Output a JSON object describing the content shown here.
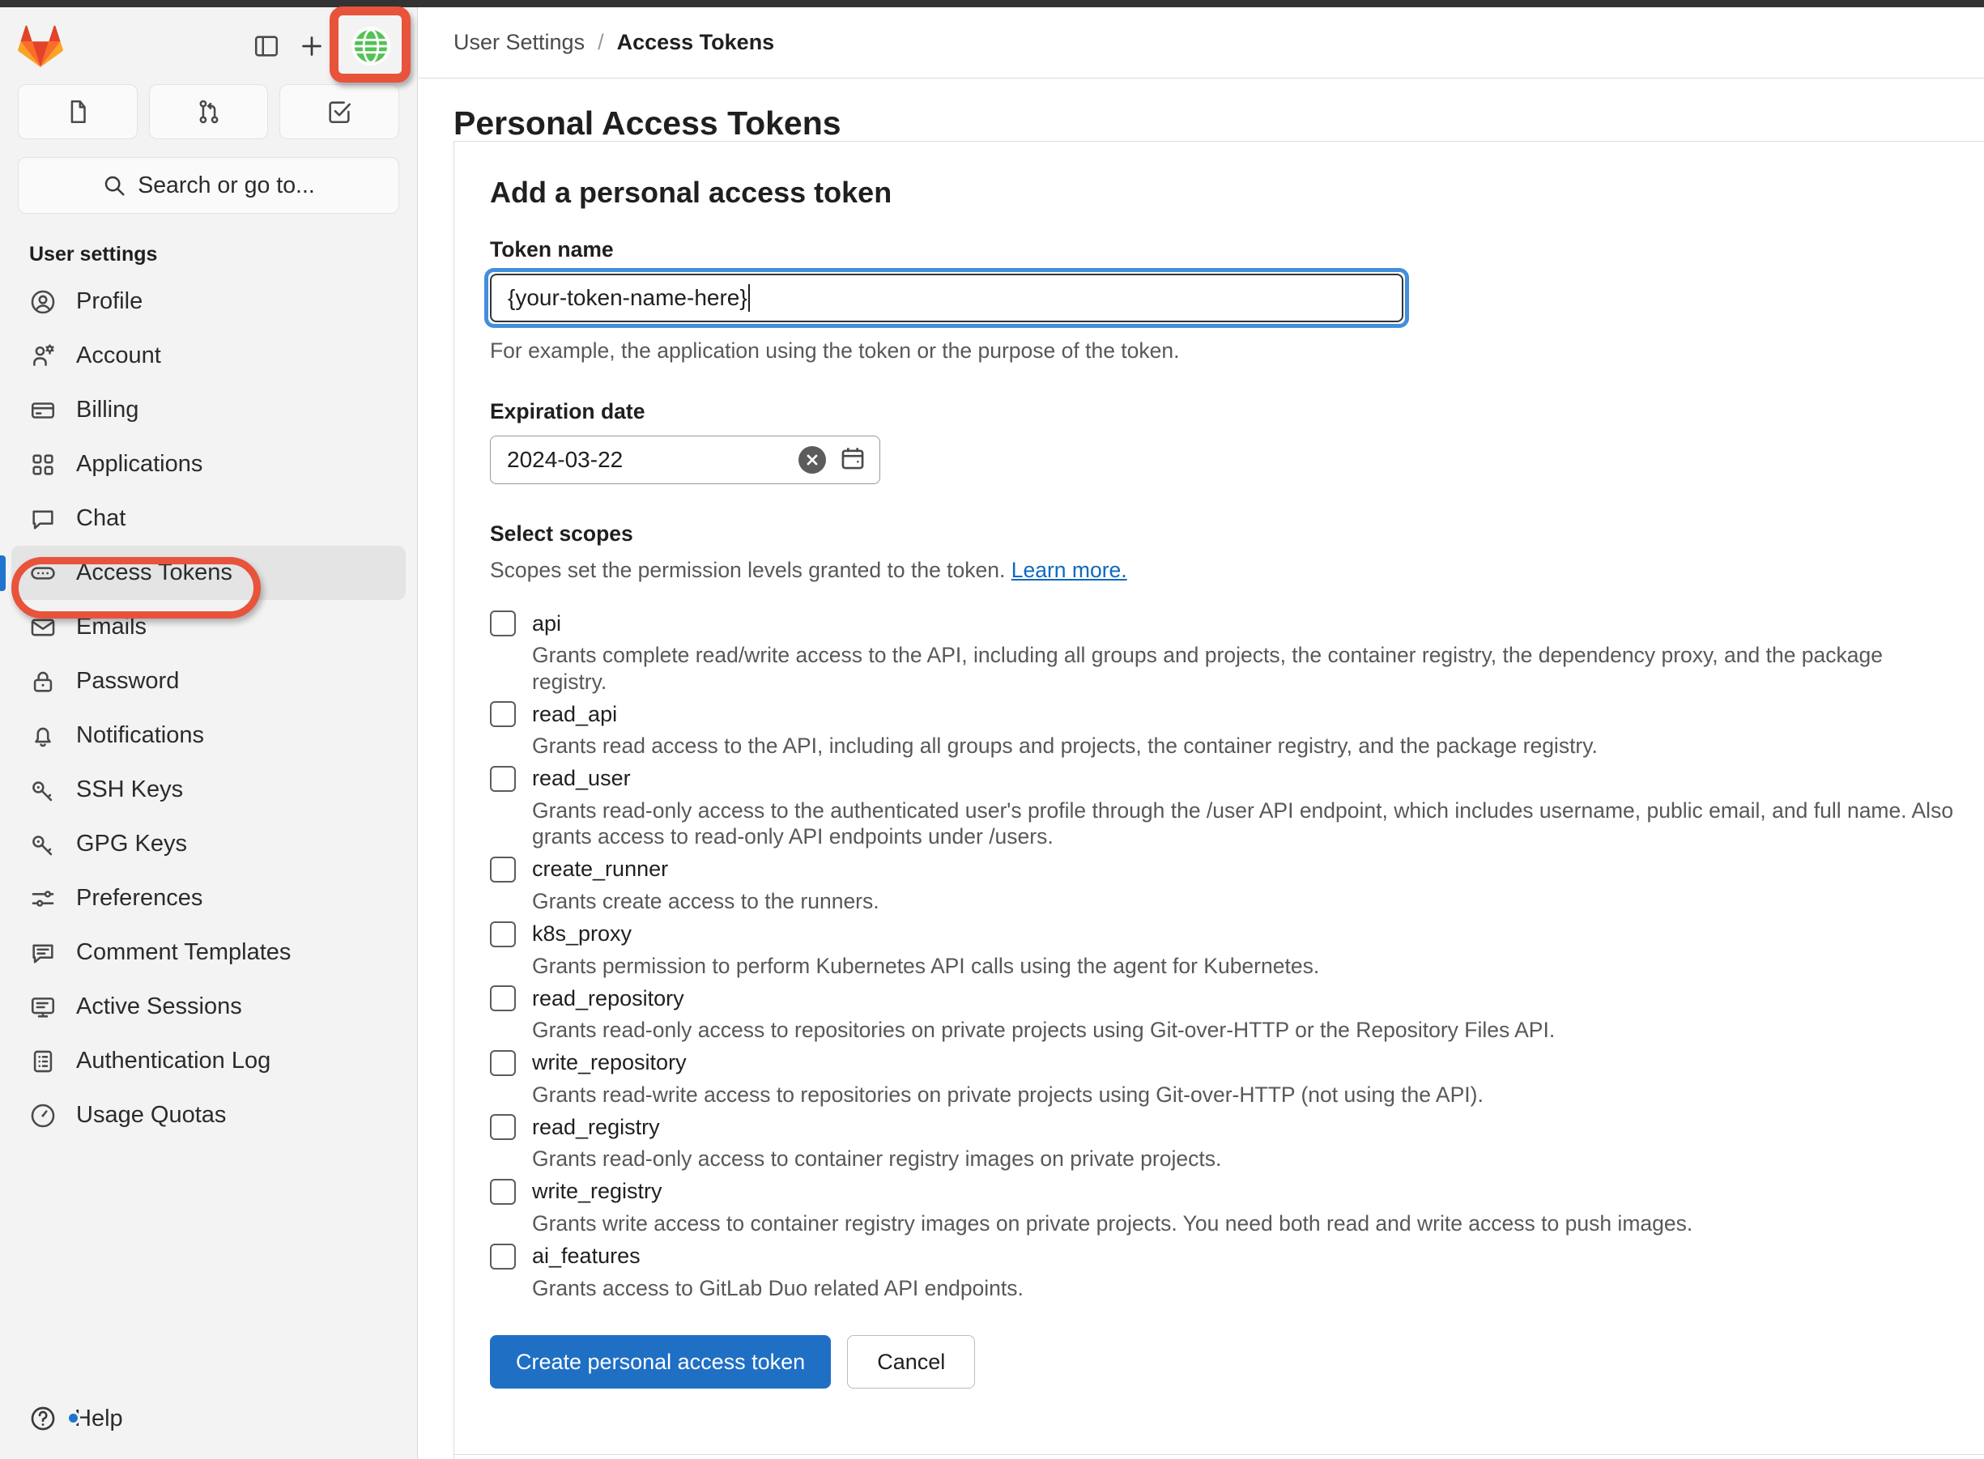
{
  "window": {
    "titlebar_color": "#333333"
  },
  "sidebar": {
    "logo": "gitlab-logo",
    "top_actions": [
      {
        "name": "toggle-sidebar-icon",
        "label": "Toggle sidebar"
      },
      {
        "name": "create-new-icon",
        "label": "Create new"
      },
      {
        "name": "user-avatar",
        "label": "User avatar"
      }
    ],
    "quick_actions": [
      {
        "name": "issues-icon",
        "label": "Issues"
      },
      {
        "name": "merge-requests-icon",
        "label": "Merge requests"
      },
      {
        "name": "todos-icon",
        "label": "To-Do List"
      }
    ],
    "search": {
      "placeholder": "Search or go to...",
      "icon": "search-icon"
    },
    "heading": "User settings",
    "items": [
      {
        "label": "Profile",
        "icon": "user-circle-icon",
        "active": false
      },
      {
        "label": "Account",
        "icon": "user-gear-icon",
        "active": false
      },
      {
        "label": "Billing",
        "icon": "credit-card-icon",
        "active": false
      },
      {
        "label": "Applications",
        "icon": "grid-apps-icon",
        "active": false
      },
      {
        "label": "Chat",
        "icon": "chat-bubble-icon",
        "active": false
      },
      {
        "label": "Access Tokens",
        "icon": "token-icon",
        "active": true
      },
      {
        "label": "Emails",
        "icon": "envelope-icon",
        "active": false
      },
      {
        "label": "Password",
        "icon": "lock-icon",
        "active": false
      },
      {
        "label": "Notifications",
        "icon": "bell-icon",
        "active": false
      },
      {
        "label": "SSH Keys",
        "icon": "key-icon",
        "active": false
      },
      {
        "label": "GPG Keys",
        "icon": "key-icon",
        "active": false
      },
      {
        "label": "Preferences",
        "icon": "sliders-icon",
        "active": false
      },
      {
        "label": "Comment Templates",
        "icon": "comment-lines-icon",
        "active": false
      },
      {
        "label": "Active Sessions",
        "icon": "monitor-icon",
        "active": false
      },
      {
        "label": "Authentication Log",
        "icon": "log-list-icon",
        "active": false
      },
      {
        "label": "Usage Quotas",
        "icon": "gauge-icon",
        "active": false
      }
    ],
    "help": {
      "label": "Help",
      "icon": "question-circle-icon",
      "has_badge": true
    }
  },
  "annotations": {
    "color": "#e8533c",
    "avatar_highlight": "user-avatar",
    "nav_highlight": "Access Tokens"
  },
  "breadcrumb": {
    "parent": "User Settings",
    "separator": "/",
    "current": "Access Tokens"
  },
  "page": {
    "title": "Personal Access Tokens"
  },
  "form": {
    "title": "Add a personal access token",
    "token_name": {
      "label": "Token name",
      "value": "{your-token-name-here}",
      "help": "For example, the application using the token or the purpose of the token.",
      "focused": true
    },
    "expiration": {
      "label": "Expiration date",
      "value": "2024-03-22",
      "clear_icon": "clear-circle-icon",
      "calendar_icon": "calendar-icon"
    },
    "scopes": {
      "label": "Select scopes",
      "help_text": "Scopes set the permission levels granted to the token.",
      "help_link": "Learn more.",
      "items": [
        {
          "name": "api",
          "checked": false,
          "description": "Grants complete read/write access to the API, including all groups and projects, the container registry, the dependency proxy, and the package registry."
        },
        {
          "name": "read_api",
          "checked": false,
          "description": "Grants read access to the API, including all groups and projects, the container registry, and the package registry."
        },
        {
          "name": "read_user",
          "checked": false,
          "description": "Grants read-only access to the authenticated user's profile through the /user API endpoint, which includes username, public email, and full name. Also grants access to read-only API endpoints under /users."
        },
        {
          "name": "create_runner",
          "checked": false,
          "description": "Grants create access to the runners."
        },
        {
          "name": "k8s_proxy",
          "checked": false,
          "description": "Grants permission to perform Kubernetes API calls using the agent for Kubernetes."
        },
        {
          "name": "read_repository",
          "checked": false,
          "description": "Grants read-only access to repositories on private projects using Git-over-HTTP or the Repository Files API."
        },
        {
          "name": "write_repository",
          "checked": false,
          "description": "Grants read-write access to repositories on private projects using Git-over-HTTP (not using the API)."
        },
        {
          "name": "read_registry",
          "checked": false,
          "description": "Grants read-only access to container registry images on private projects."
        },
        {
          "name": "write_registry",
          "checked": false,
          "description": "Grants write access to container registry images on private projects. You need both read and write access to push images."
        },
        {
          "name": "ai_features",
          "checked": false,
          "description": "Grants access to GitLab Duo related API endpoints."
        }
      ]
    },
    "actions": {
      "submit_label": "Create personal access token",
      "submit_color": "#1f6fc4",
      "cancel_label": "Cancel"
    }
  }
}
